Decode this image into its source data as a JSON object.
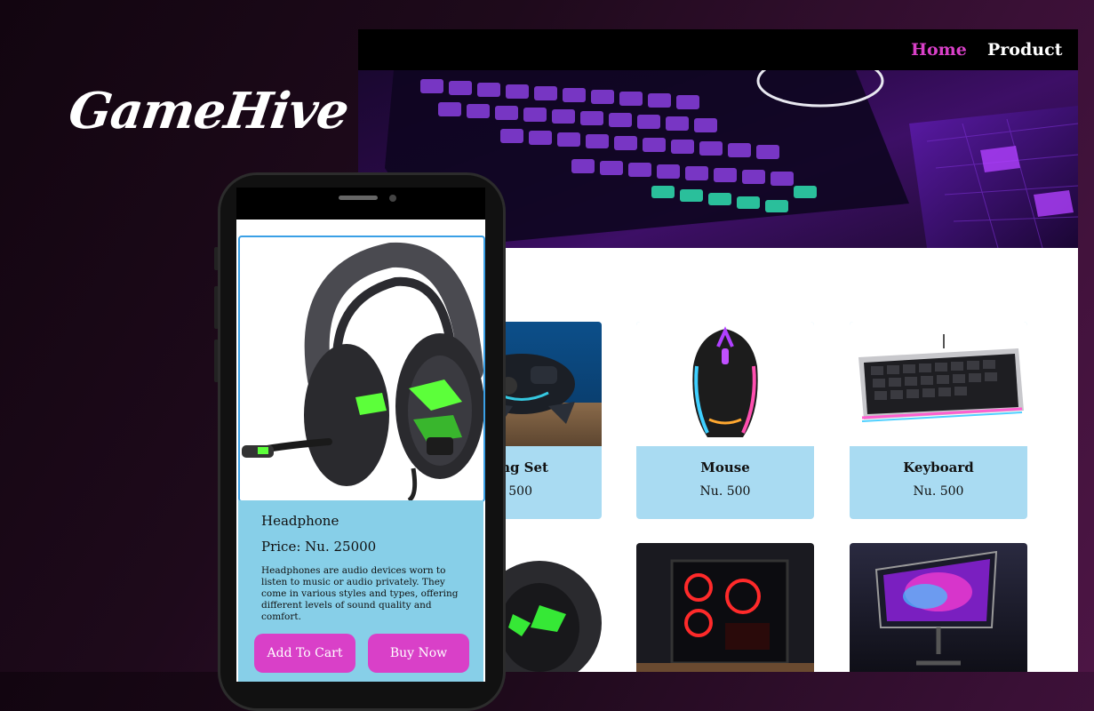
{
  "brand": {
    "name": "GameHive"
  },
  "nav": {
    "home": "Home",
    "product": "Product"
  },
  "colors": {
    "accent": "#d940c8",
    "nav_active": "#d940c8",
    "card_bg": "#a9dbf2",
    "detail_bg": "#87cfe8"
  },
  "products": [
    {
      "name": "Gaming Set",
      "price": "Nu. 500",
      "visible_name": "ming Set",
      "visible_price": "u. 500"
    },
    {
      "name": "Mouse",
      "price": "Nu. 500"
    },
    {
      "name": "Keyboard",
      "price": "Nu. 500"
    }
  ],
  "phone": {
    "product_name": "Headphone",
    "price": "Price: Nu. 25000",
    "description": "Headphones are audio devices worn to listen to music or audio privately. They come in various styles and types, offering different levels of sound quality and comfort.",
    "add_to_cart": "Add To Cart",
    "buy_now": "Buy Now"
  }
}
